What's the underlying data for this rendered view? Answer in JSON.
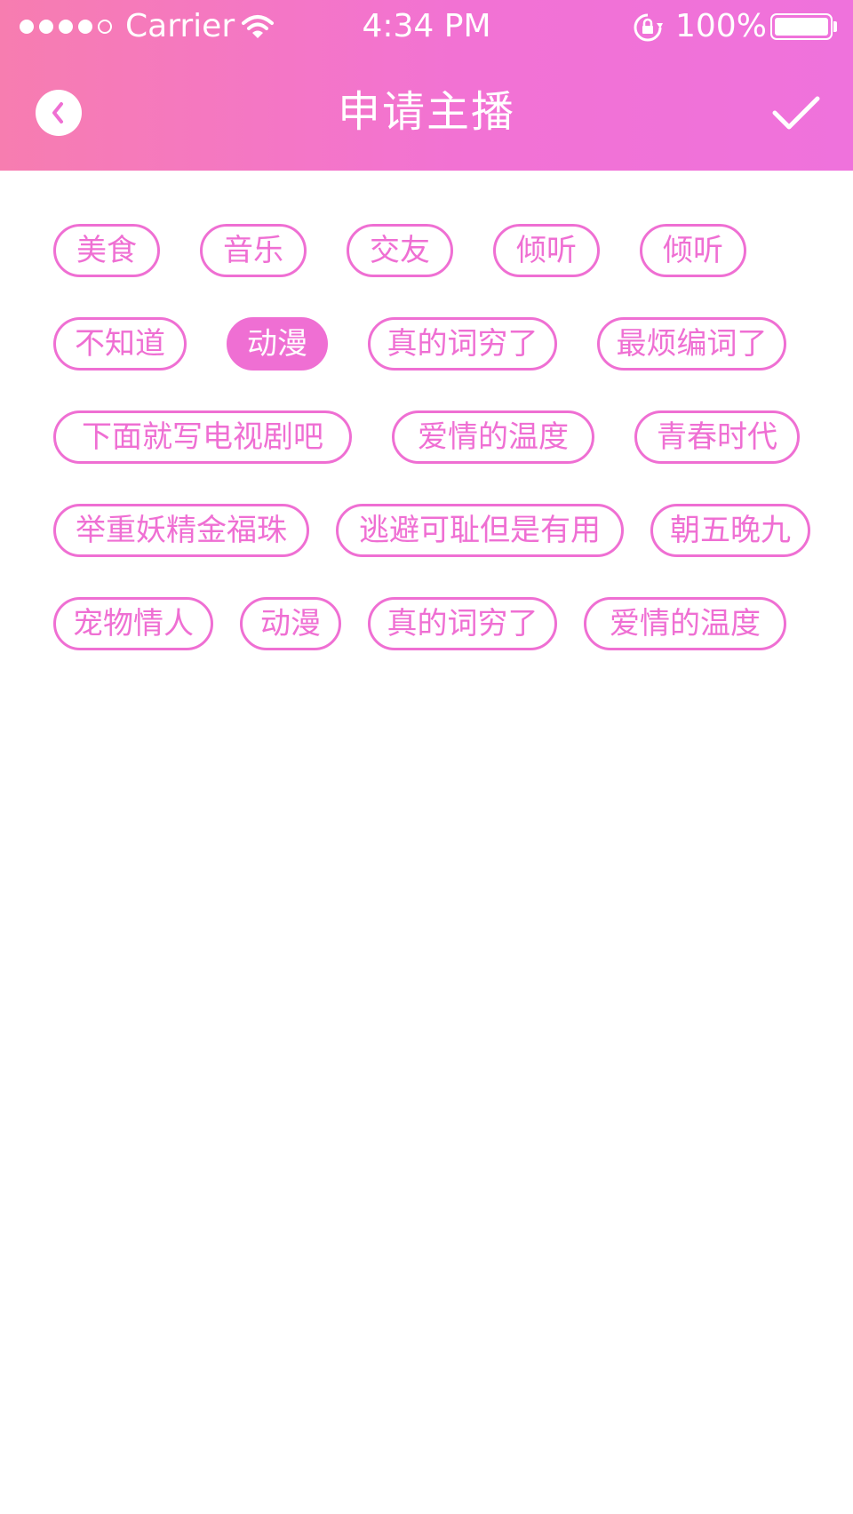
{
  "status_bar": {
    "carrier": "Carrier",
    "time": "4:34 PM",
    "battery": "100%"
  },
  "nav": {
    "title": "申请主播",
    "back_icon": "back-chevron-icon",
    "confirm_icon": "checkmark-icon"
  },
  "colors": {
    "accent": "#ef6fd3",
    "header_start": "#f77db0",
    "header_end": "#ef72dc"
  },
  "tags": [
    {
      "label": "美食",
      "selected": false
    },
    {
      "label": "音乐",
      "selected": false
    },
    {
      "label": "交友",
      "selected": false
    },
    {
      "label": "倾听",
      "selected": false
    },
    {
      "label": "倾听",
      "selected": false
    },
    {
      "label": "不知道",
      "selected": false
    },
    {
      "label": "动漫",
      "selected": true
    },
    {
      "label": "真的词穷了",
      "selected": false
    },
    {
      "label": "最烦编词了",
      "selected": false
    },
    {
      "label": "下面就写电视剧吧",
      "selected": false
    },
    {
      "label": "爱情的温度",
      "selected": false
    },
    {
      "label": "青春时代",
      "selected": false
    },
    {
      "label": "举重妖精金福珠",
      "selected": false
    },
    {
      "label": "逃避可耻但是有用",
      "selected": false
    },
    {
      "label": "朝五晚九",
      "selected": false
    },
    {
      "label": "宠物情人",
      "selected": false
    },
    {
      "label": "动漫",
      "selected": false
    },
    {
      "label": "真的词穷了",
      "selected": false
    },
    {
      "label": "爱情的温度",
      "selected": false
    }
  ]
}
